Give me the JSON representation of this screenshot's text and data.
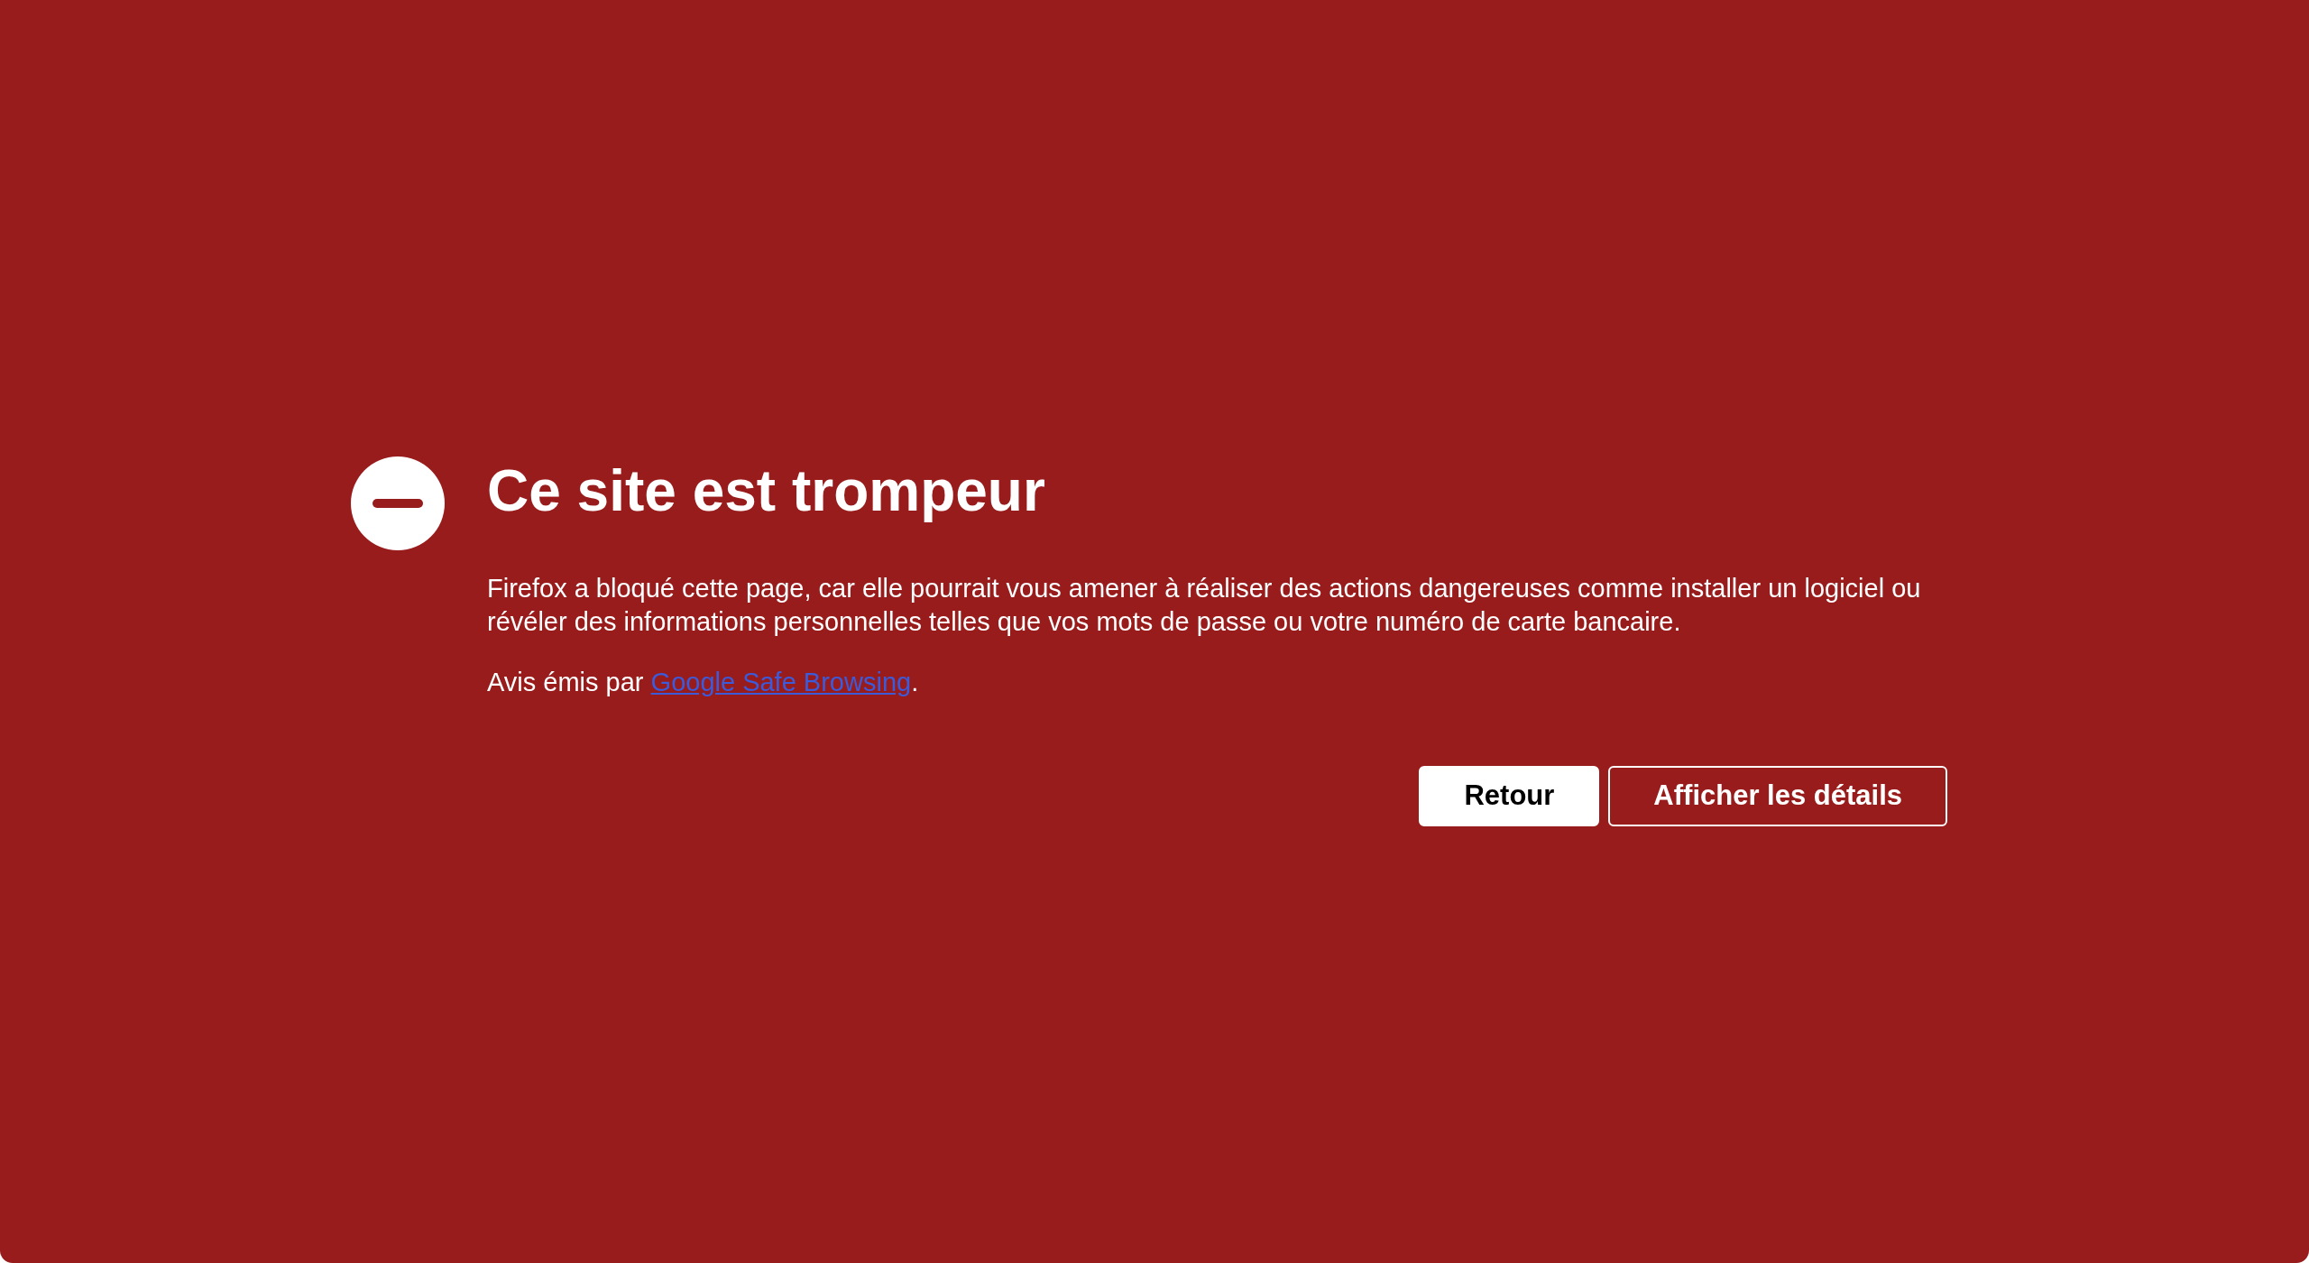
{
  "title": "Ce site est trompeur",
  "description": "Firefox a bloqué cette page, car elle pourrait vous amener à réaliser des actions dangereuses comme installer un logiciel ou révéler des informations personnelles telles que vos mots de passe ou votre numéro de carte bancaire.",
  "advisory": {
    "text": "Avis émis par ",
    "link": "Google Safe Browsing",
    "suffix": "."
  },
  "buttons": [
    {
      "label": "Retour",
      "kind": "primary"
    },
    {
      "label": "Afficher les détails",
      "kind": "secondary"
    }
  ]
}
